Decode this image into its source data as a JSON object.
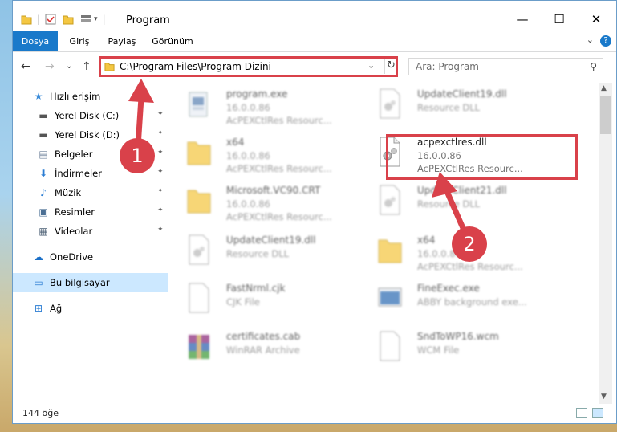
{
  "window": {
    "title": "Program",
    "controls": {
      "minimize": "—",
      "maximize": "☐",
      "close": "✕"
    }
  },
  "ribbon": {
    "tabs": [
      "Dosya",
      "Giriş",
      "Paylaş",
      "Görünüm"
    ],
    "active_tab": "Dosya",
    "expand": "⌄",
    "help": "?"
  },
  "nav": {
    "back": "←",
    "forward": "→",
    "recent": "⌄",
    "up": "↑",
    "address": "C:\\Program Files\\Program Dizini",
    "address_dropdown": "⌄",
    "refresh": "↻",
    "search_placeholder": "Ara: Program",
    "search_icon": "⚲"
  },
  "sidebar": {
    "items": [
      {
        "label": "Hızlı erişim",
        "icon": "star-icon",
        "glyph": "★",
        "pinned": false
      },
      {
        "label": "Yerel Disk (C:)",
        "icon": "drive-icon",
        "glyph": "▬",
        "pinned": true
      },
      {
        "label": "Yerel Disk (D:)",
        "icon": "drive-icon",
        "glyph": "▬",
        "pinned": true
      },
      {
        "label": "Belgeler",
        "icon": "documents-icon",
        "glyph": "▤",
        "pinned": true
      },
      {
        "label": "İndirmeler",
        "icon": "download-icon",
        "glyph": "⬇",
        "pinned": true
      },
      {
        "label": "Müzik",
        "icon": "music-icon",
        "glyph": "♪",
        "pinned": true
      },
      {
        "label": "Resimler",
        "icon": "pictures-icon",
        "glyph": "▣",
        "pinned": true
      },
      {
        "label": "Videolar",
        "icon": "videos-icon",
        "glyph": "▦",
        "pinned": true
      },
      {
        "label": "OneDrive",
        "icon": "cloud-icon",
        "glyph": "☁",
        "pinned": false
      },
      {
        "label": "Bu bilgisayar",
        "icon": "computer-icon",
        "glyph": "▭",
        "pinned": false
      },
      {
        "label": "Ağ",
        "icon": "network-icon",
        "glyph": "⊞",
        "pinned": false
      }
    ],
    "pin_glyph": "📌"
  },
  "files": [
    {
      "name": "program.exe",
      "line2": "16.0.0.86",
      "line3": "AcPEXCtlRes Resourc...",
      "kind": "exe"
    },
    {
      "name": "UpdateClient19.dll",
      "line2": "Resource DLL",
      "line3": "",
      "kind": "dll"
    },
    {
      "name": "x64",
      "line2": "16.0.0.86",
      "line3": "AcPEXCtlRes Resourc...",
      "kind": "folder"
    },
    {
      "name": "acpexctlres.dll",
      "line2": "16.0.0.86",
      "line3": "AcPEXCtlRes Resourc...",
      "kind": "dll"
    },
    {
      "name": "Microsoft.VC90.CRT",
      "line2": "16.0.0.86",
      "line3": "AcPEXCtlRes Resourc...",
      "kind": "folder"
    },
    {
      "name": "UpdateClient21.dll",
      "line2": "Resource DLL",
      "line3": "",
      "kind": "dll"
    },
    {
      "name": "UpdateClient19.dll",
      "line2": "Resource DLL",
      "line3": "",
      "kind": "dll"
    },
    {
      "name": "x64",
      "line2": "16.0.0.86",
      "line3": "AcPEXCtlRes Resourc...",
      "kind": "folder"
    },
    {
      "name": "FastNrml.cjk",
      "line2": "CJK File",
      "line3": "",
      "kind": "blank"
    },
    {
      "name": "FineExec.exe",
      "line2": "ABBY background exe...",
      "line3": "",
      "kind": "app"
    },
    {
      "name": "certificates.cab",
      "line2": "WinRAR Archive",
      "line3": "",
      "kind": "rar"
    },
    {
      "name": "SndToWP16.wcm",
      "line2": "WCM File",
      "line3": "",
      "kind": "blank"
    }
  ],
  "status": {
    "count": "144 öğe"
  },
  "annotations": {
    "step1": "1",
    "step2": "2",
    "highlight_color": "#d9414a"
  },
  "colors": {
    "accent": "#1979ca",
    "selected": "#cce8ff",
    "folder": "#f4c742"
  }
}
